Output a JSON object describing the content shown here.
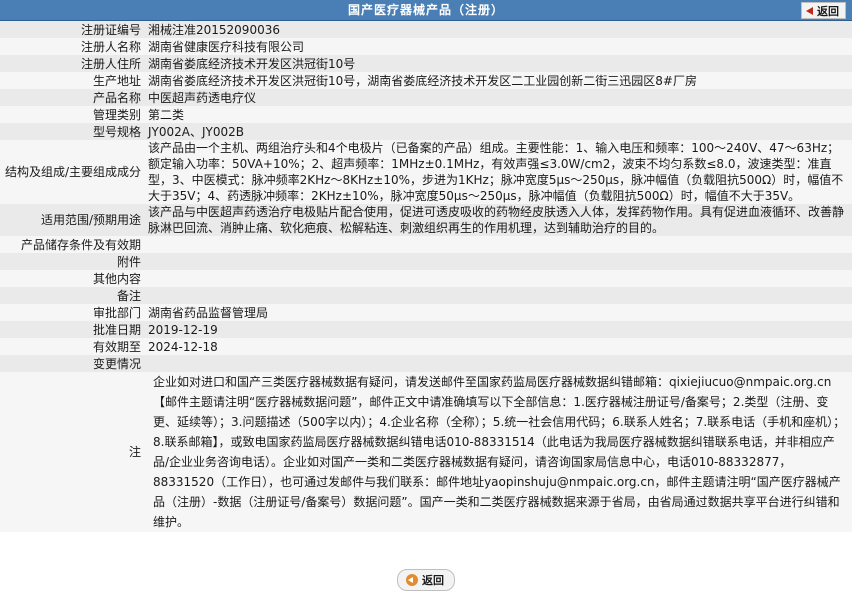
{
  "header": {
    "title": "国产医疗器械产品（注册）",
    "back_label": "返回"
  },
  "rows": [
    {
      "label": "注册证编号",
      "value": "湘械注准20152090036"
    },
    {
      "label": "注册人名称",
      "value": "湖南省健康医疗科技有限公司"
    },
    {
      "label": "注册人住所",
      "value": "湖南省娄底经济技术开发区洪冠街10号"
    },
    {
      "label": "生产地址",
      "value": "湖南省娄底经济技术开发区洪冠街10号，湖南省娄底经济技术开发区二工业园创新二街三迅园区8#厂房"
    },
    {
      "label": "产品名称",
      "value": "中医超声药透电疗仪"
    },
    {
      "label": "管理类别",
      "value": "第二类"
    },
    {
      "label": "型号规格",
      "value": "JY002A、JY002B"
    },
    {
      "label": "结构及组成/主要组成成分",
      "value": "该产品由一个主机、两组治疗头和4个电极片（已备案的产品）组成。主要性能：1、输入电压和频率：100～240V、47～63Hz；额定输入功率：50VA+10%；2、超声频率：1MHz±0.1MHz，有效声强≤3.0W/cm2，波束不均匀系数≤8.0，波速类型：准直型，3、中医模式：脉冲频率2KHz～8KHz±10%，步进为1KHz；脉冲宽度5μs～250μs，脉冲幅值（负载阻抗500Ω）时，幅值不大于35V；4、药透脉冲频率：2KHz±10%，脉冲宽度50μs～250μs，脉冲幅值（负载阻抗500Ω）时，幅值不大于35V。"
    },
    {
      "label": "适用范围/预期用途",
      "value": "该产品与中医超声药透治疗电极贴片配合使用，促进可透皮吸收的药物经皮肤透入人体，发挥药物作用。具有促进血液循环、改善静脉淋巴回流、消肿止痛、软化疤痕、松解粘连、刺激组织再生的作用机理，达到辅助治疗的目的。"
    },
    {
      "label": "产品储存条件及有效期",
      "value": ""
    },
    {
      "label": "附件",
      "value": ""
    },
    {
      "label": "其他内容",
      "value": ""
    },
    {
      "label": "备注",
      "value": ""
    },
    {
      "label": "审批部门",
      "value": "湖南省药品监督管理局"
    },
    {
      "label": "批准日期",
      "value": "2019-12-19"
    },
    {
      "label": "有效期至",
      "value": "2024-12-18"
    },
    {
      "label": "变更情况",
      "value": ""
    }
  ],
  "note": {
    "label": "注",
    "text": "企业如对进口和国产三类医疗器械数据有疑问，请发送邮件至国家药监局医疗器械数据纠错邮箱：qixiejiucuo@nmpaic.org.cn【邮件主题请注明“医疗器械数据问题”，邮件正文中请准确填写以下全部信息：1.医疗器械注册证号/备案号；2.类型（注册、变更、延续等）；3.问题描述（500字以内）；4.企业名称（全称）；5.统一社会信用代码；6.联系人姓名；7.联系电话（手机和座机）；8.联系邮箱】，或致电国家药监局医疗器械数据纠错电话010-88331514（此电话为我局医疗器械数据纠错联系电话，并非相应产品/企业业务咨询电话）。企业如对国产一类和二类医疗器械数据有疑问，请咨询国家局信息中心，电话010-88332877，88331520（工作日），也可通过发邮件与我们联系：邮件地址yaopinshuju@nmpaic.org.cn，邮件主题请注明“国产医疗器械产品（注册）-数据（注册证号/备案号）数据问题”。国产一类和二类医疗器械数据来源于省局，由省局通过数据共享平台进行纠错和维护。"
  },
  "footer": {
    "back_label": "返回"
  }
}
